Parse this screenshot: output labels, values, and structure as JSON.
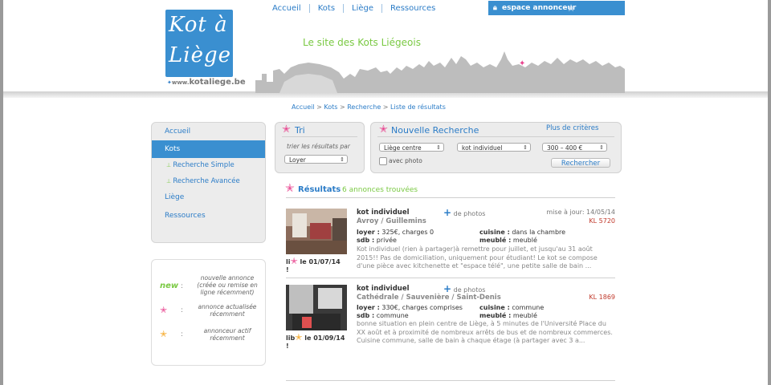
{
  "header": {
    "logo_line1": "Kot à",
    "logo_line2": "Liège",
    "logo_url_prefix": "www.",
    "logo_url_main": "kotaliege.be",
    "tagline": "Le site des Kots Liégeois",
    "nav": [
      "Accueil",
      "Kots",
      "Liège",
      "Ressources"
    ],
    "espace_label": "espace annonceur"
  },
  "breadcrumb": [
    "Accueil",
    "Kots",
    "Recherche",
    "Liste de résultats"
  ],
  "sidebar": {
    "items": [
      {
        "label": "Accueil"
      },
      {
        "label": "Kots"
      },
      {
        "label": "Recherche Simple"
      },
      {
        "label": "Recherche Avancée"
      },
      {
        "label": "Liège"
      },
      {
        "label": "Ressources"
      }
    ]
  },
  "legend": {
    "new_label": "new",
    "items": [
      {
        "text": "nouvelle annonce (créée ou remise en ligne récemment)"
      },
      {
        "text": "annonce actualisée récemment"
      },
      {
        "text": "annonceur actif récemment"
      }
    ]
  },
  "tri": {
    "title": "Tri",
    "subtitle": "trier les résultats par",
    "selected": "Loyer"
  },
  "search": {
    "title": "Nouvelle Recherche",
    "more_criteria": "Plus de critères",
    "zone": "Liège centre",
    "type": "kot individuel",
    "price": "300 – 400 €",
    "photo_label": "avec photo",
    "submit": "Rechercher"
  },
  "results": {
    "title": "Résultats",
    "count": "6 annonces trouvées"
  },
  "listings": [
    {
      "type": "kot individuel",
      "photos_label": "de photos",
      "update": "mise à jour: 14/05/14",
      "address": "Avroy / Guillemins",
      "ref": "KL 5720",
      "loyer": "325€, charges 0",
      "sdb": "privée",
      "cuisine": "dans la chambre",
      "meuble": "meublé",
      "avail_prefix": "li",
      "avail_date": "le 01/07/14",
      "avail_suffix": "!",
      "desc": "Kot individuel (rien à partager)à remettre pour juillet, et jusqu'au 31 août 2015!! Pas de domiciliation, uniquement pour étudiant! Le kot se compose d'une pièce avec kitchenette et \"espace télé\", une petite salle de bain ..."
    },
    {
      "type": "kot individuel",
      "photos_label": "de photos",
      "update": "",
      "address": "Cathédrale / Sauvenière / Saint-Denis",
      "ref": "KL 1869",
      "loyer": "330€, charges comprises",
      "sdb": "commune",
      "cuisine": "commune",
      "meuble": "meublé",
      "avail_prefix": "lib",
      "avail_date": "le 01/09/14",
      "avail_suffix": "!",
      "desc": "bonne situation en plein centre de Liège, à 5 minutes de l'Université Place du XX août et à proximité de nombreux arrêts de bus et de nombreux commerces. Cuisine commune, salle de bain à chaque étage (à partager avec 3 a..."
    }
  ],
  "labels": {
    "loyer": "loyer :",
    "sdb": "sdb :",
    "cuisine": "cuisine :",
    "meuble": "meublé :"
  },
  "colors": {
    "brand_blue": "#3a8fd0",
    "accent_green": "#7ac943",
    "accent_pink": "#e8438e",
    "accent_orange": "#f5a623",
    "ref_red": "#c0392b"
  }
}
